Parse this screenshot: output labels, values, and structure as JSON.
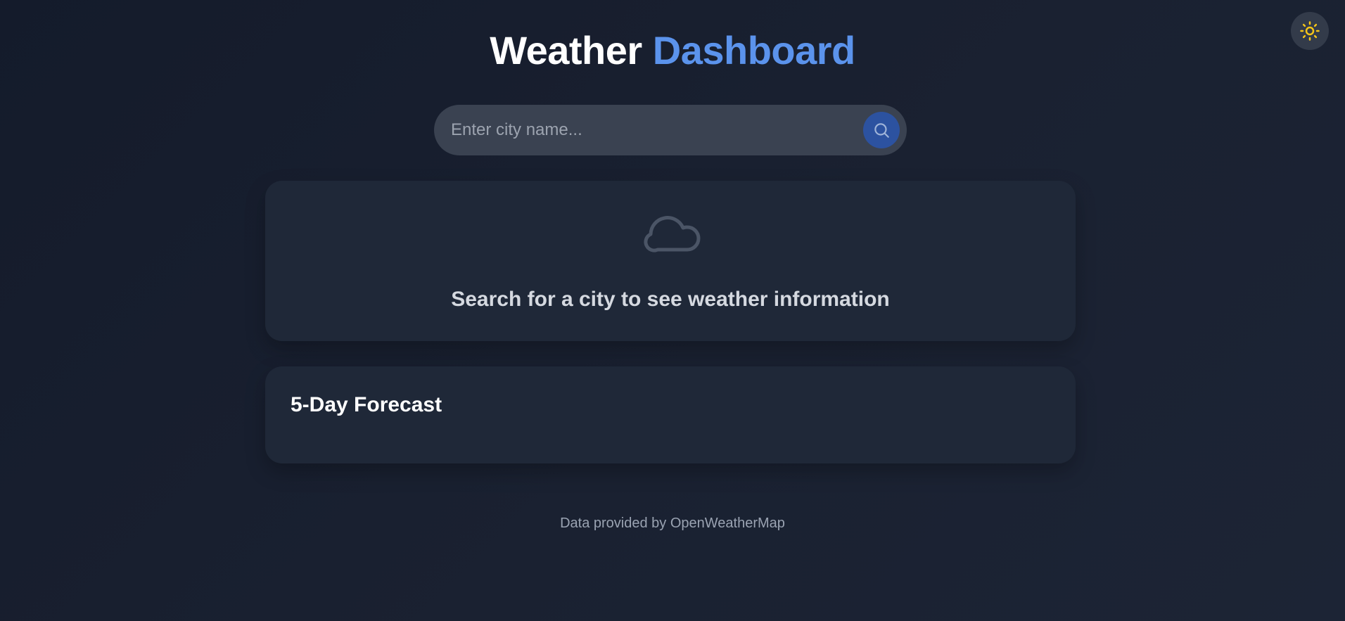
{
  "header": {
    "title_part1": "Weather",
    "title_part2": "Dashboard"
  },
  "theme_toggle": {
    "icon": "sun-icon",
    "icon_color": "#f5c518"
  },
  "search": {
    "placeholder": "Enter city name...",
    "value": "",
    "button_icon": "search-icon"
  },
  "empty_state": {
    "icon": "cloud-icon",
    "message": "Search for a city to see weather information"
  },
  "forecast": {
    "title": "5-Day Forecast"
  },
  "footer": {
    "text": "Data provided by OpenWeatherMap"
  },
  "colors": {
    "accent": "#5b93ec",
    "search_button": "#2c52a0",
    "card": "#1f2838"
  }
}
